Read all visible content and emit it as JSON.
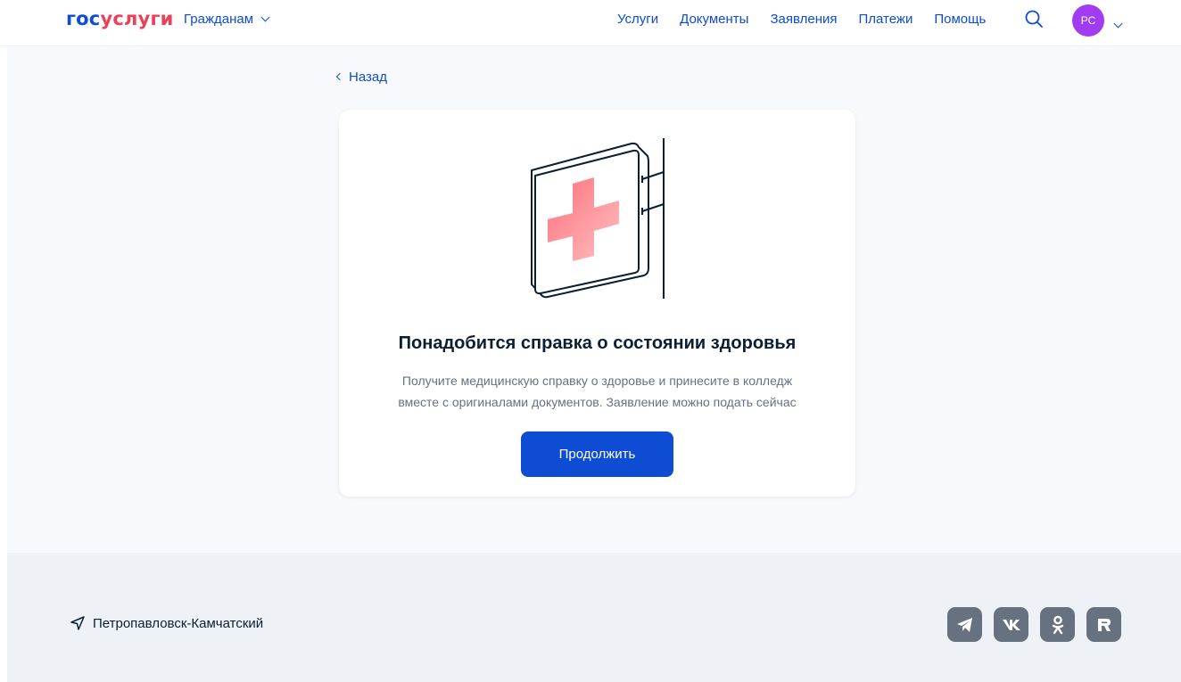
{
  "header": {
    "logo_part1": "гос",
    "logo_part2": "услуги",
    "citizens_label": "Гражданам",
    "nav": [
      {
        "label": "Услуги"
      },
      {
        "label": "Документы"
      },
      {
        "label": "Заявления"
      },
      {
        "label": "Платежи"
      },
      {
        "label": "Помощь"
      }
    ],
    "avatar_initials": "РС"
  },
  "main": {
    "back_label": "Назад",
    "card": {
      "title": "Понадобится справка о состоянии здоровья",
      "text_line1": "Получите медицинскую справку о здоровье и принесите в колледж",
      "text_line2": "вместе с оригиналами документов. Заявление можно подать сейчас",
      "button_label": "Продолжить"
    }
  },
  "footer": {
    "city": "Петропавловск-Камчатский",
    "social": [
      "telegram-icon",
      "vk-icon",
      "ok-icon",
      "rutube-icon"
    ]
  },
  "colors": {
    "primary": "#0d4cd3",
    "logo_red": "#ee3f58",
    "avatar": "#a23cf2",
    "text": "#0b1f33",
    "muted": "#66727f"
  }
}
